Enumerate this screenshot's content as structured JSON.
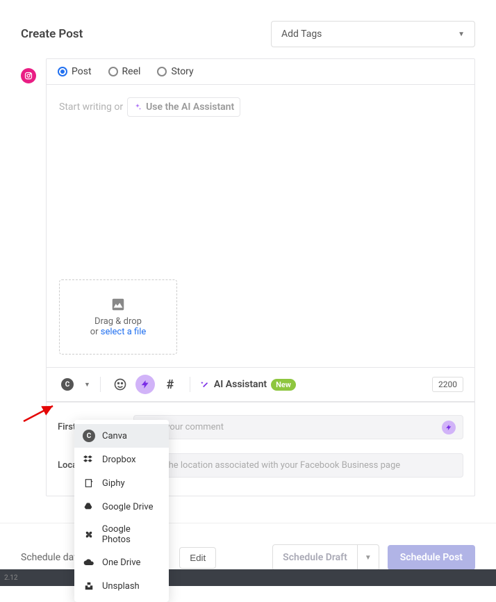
{
  "header": {
    "title": "Create Post",
    "tags_label": "Add Tags"
  },
  "platform": "instagram-icon",
  "types": {
    "post": "Post",
    "reel": "Reel",
    "story": "Story",
    "selected": "post"
  },
  "editor": {
    "placeholder_prefix": "Start writing or",
    "ai_chip": "Use the AI Assistant"
  },
  "upload": {
    "line1": "Drag & drop",
    "line2_prefix": "or ",
    "link": "select a file"
  },
  "toolbar": {
    "ai_label": "AI Assistant",
    "new_badge": "New",
    "char_count": "2200"
  },
  "dropdown": {
    "items": [
      {
        "id": "canva",
        "label": "Canva",
        "icon": "canva-icon",
        "selected": true
      },
      {
        "id": "dropbox",
        "label": "Dropbox",
        "icon": "dropbox-icon"
      },
      {
        "id": "giphy",
        "label": "Giphy",
        "icon": "giphy-icon"
      },
      {
        "id": "gdrive",
        "label": "Google Drive",
        "icon": "google-drive-icon"
      },
      {
        "id": "gphotos",
        "label": "Google Photos",
        "icon": "google-photos-icon"
      },
      {
        "id": "onedrive",
        "label": "One Drive",
        "icon": "onedrive-icon"
      },
      {
        "id": "unsplash",
        "label": "Unsplash",
        "icon": "unsplash-icon"
      }
    ]
  },
  "fields": {
    "first_comment_label": "First Comment",
    "first_comment_placeholder": "Enter your comment",
    "location_label": "Location Tag",
    "location_placeholder": "Enter the location associated with your Facebook Business page"
  },
  "footer": {
    "schedule_label": "Schedule date",
    "edit": "Edit",
    "schedule_draft": "Schedule Draft",
    "schedule_post": "Schedule Post"
  },
  "baseline": "2.12"
}
